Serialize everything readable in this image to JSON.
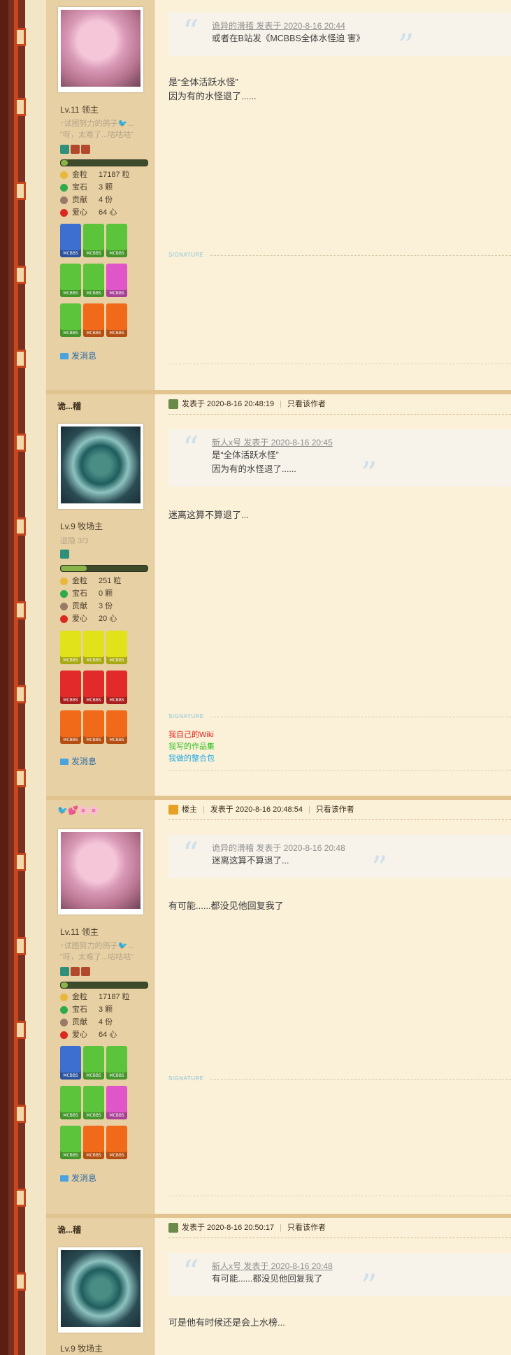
{
  "colors": {
    "rail": "#6d2a1a",
    "sidebar": "#e6d0a4",
    "content": "#fbf1d9",
    "link_red": "#e0201a",
    "link_green": "#2fbf1f",
    "link_blue": "#1ea8e0"
  },
  "posts": [
    {
      "level": "Lv.11 领主",
      "sig_lines": [
        "↑试图努力的鸽子🐦...",
        "\"呀，太难了...咕咕咕\""
      ],
      "stats": [
        {
          "label": "金粒",
          "value": "17187 粒",
          "icon": "gold-nugget-icon"
        },
        {
          "label": "宝石",
          "value": "3 颗",
          "icon": "emerald-icon"
        },
        {
          "label": "贡献",
          "value": "4 份",
          "icon": "contribution-icon"
        },
        {
          "label": "爱心",
          "value": "64 心",
          "icon": "apple-heart-icon"
        }
      ],
      "send_message": "发消息",
      "quote_author_line": "诡异的滑稽 发表于 2020-8-16 20:44",
      "quote_lines": [
        "或者在B站发《MCBBS全体水怪迫 害》"
      ],
      "body_lines": [
        "是“全体活跃水怪”",
        "因为有的水怪退了......"
      ],
      "signature_label": "SIGNATURE"
    },
    {
      "author": "诡...稽",
      "level": "Lv.9 牧场主",
      "sig_lines": [
        "退隐 3/3"
      ],
      "stats": [
        {
          "label": "金粒",
          "value": "251 粒",
          "icon": "gold-nugget-icon"
        },
        {
          "label": "宝石",
          "value": "0 颗",
          "icon": "emerald-icon"
        },
        {
          "label": "贡献",
          "value": "3 份",
          "icon": "contribution-icon"
        },
        {
          "label": "爱心",
          "value": "20 心",
          "icon": "apple-heart-icon"
        }
      ],
      "send_message": "发消息",
      "posted_at": "发表于 2020-8-16 20:48:19",
      "only_author": "只看该作者",
      "quote_author_line": "新人x号 发表于 2020-8-16 20:45",
      "quote_lines": [
        "是“全体活跃水怪”",
        "因为有的水怪退了......"
      ],
      "body_lines": [
        "迷离这算不算退了..."
      ],
      "signature_label": "SIGNATURE",
      "sig_links": [
        "我自己的Wiki",
        "我写的作品集",
        "我做的整合包"
      ]
    },
    {
      "author": "🐦💕🌸🌸",
      "level": "Lv.11 领主",
      "sig_lines": [
        "↑试图努力的鸽子🐦...",
        "\"呀，太难了...咕咕咕\""
      ],
      "stats": [
        {
          "label": "金粒",
          "value": "17187 粒",
          "icon": "gold-nugget-icon"
        },
        {
          "label": "宝石",
          "value": "3 颗",
          "icon": "emerald-icon"
        },
        {
          "label": "贡献",
          "value": "4 份",
          "icon": "contribution-icon"
        },
        {
          "label": "爱心",
          "value": "64 心",
          "icon": "apple-heart-icon"
        }
      ],
      "send_message": "发消息",
      "op_tag": "楼主",
      "posted_at": "发表于 2020-8-16 20:48:54",
      "only_author": "只看该作者",
      "quote_author_line": "诡异的滑稽 发表于 2020-8-16 20:48",
      "quote_lines": [
        "迷离这算不算退了..."
      ],
      "body_lines": [
        "有可能......都没见他回复我了"
      ],
      "signature_label": "SIGNATURE"
    },
    {
      "author": "诡...稽",
      "level": "Lv.9 牧场主",
      "posted_at": "发表于 2020-8-16 20:50:17",
      "only_author": "只看该作者",
      "quote_author_line": "新人x号 发表于 2020-8-16 20:48",
      "quote_lines": [
        "有可能......都没见他回复我了"
      ],
      "body_lines": [
        "可是他有时候还是会上水榜..."
      ]
    }
  ]
}
